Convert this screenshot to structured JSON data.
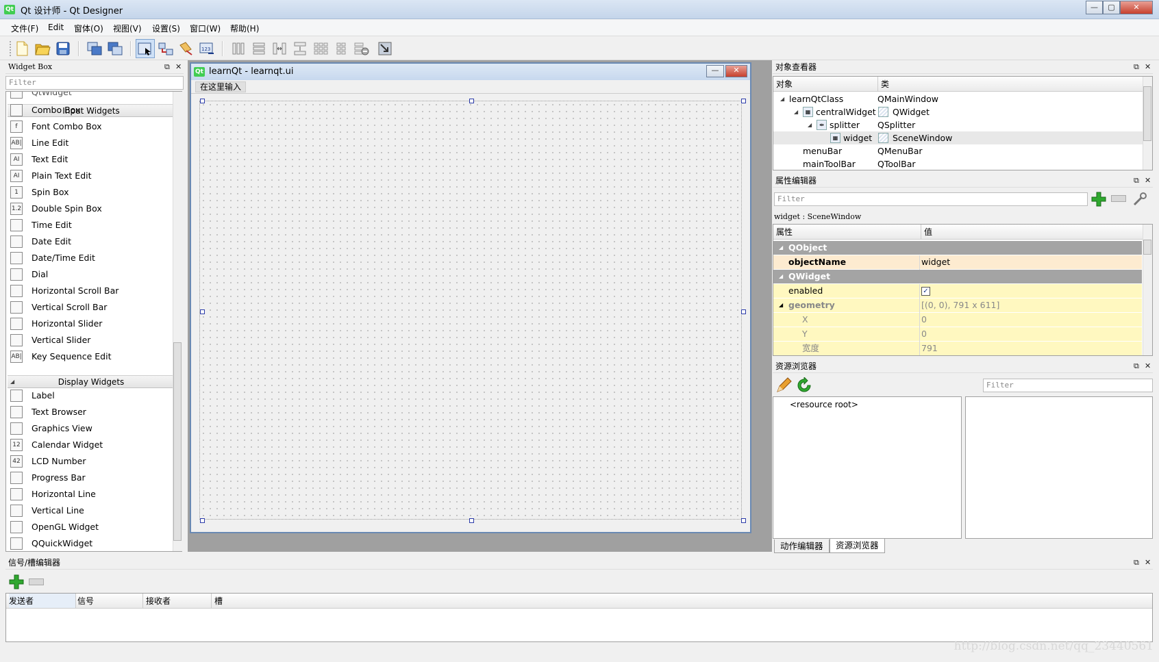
{
  "window": {
    "title": "Qt 设计师 - Qt Designer",
    "app_icon": "Qt",
    "min": "—",
    "max": "▢",
    "close": "✕"
  },
  "menubar": [
    "文件(F)",
    "Edit",
    "窗体(O)",
    "视图(V)",
    "设置(S)",
    "窗口(W)",
    "帮助(H)"
  ],
  "widget_box": {
    "title": "Widget Box",
    "filter_placeholder": "Filter",
    "partial_item": "QtWidget",
    "categories": [
      "Input Widgets",
      "Display Widgets"
    ],
    "input_widgets": [
      {
        "label": "Combo Box",
        "icon": "combo-box-icon"
      },
      {
        "label": "Font Combo Box",
        "icon": "font-combo-box-icon"
      },
      {
        "label": "Line Edit",
        "icon": "line-edit-icon"
      },
      {
        "label": "Text Edit",
        "icon": "text-edit-icon"
      },
      {
        "label": "Plain Text Edit",
        "icon": "plain-text-edit-icon"
      },
      {
        "label": "Spin Box",
        "icon": "spin-box-icon"
      },
      {
        "label": "Double Spin Box",
        "icon": "double-spin-box-icon"
      },
      {
        "label": "Time Edit",
        "icon": "time-edit-icon"
      },
      {
        "label": "Date Edit",
        "icon": "date-edit-icon"
      },
      {
        "label": "Date/Time Edit",
        "icon": "date-time-edit-icon"
      },
      {
        "label": "Dial",
        "icon": "dial-icon"
      },
      {
        "label": "Horizontal Scroll Bar",
        "icon": "horizontal-scroll-bar-icon"
      },
      {
        "label": "Vertical Scroll Bar",
        "icon": "vertical-scroll-bar-icon"
      },
      {
        "label": "Horizontal Slider",
        "icon": "horizontal-slider-icon"
      },
      {
        "label": "Vertical Slider",
        "icon": "vertical-slider-icon"
      },
      {
        "label": "Key Sequence Edit",
        "icon": "key-sequence-edit-icon"
      }
    ],
    "display_widgets": [
      {
        "label": "Label",
        "icon": "label-icon"
      },
      {
        "label": "Text Browser",
        "icon": "text-browser-icon"
      },
      {
        "label": "Graphics View",
        "icon": "graphics-view-icon"
      },
      {
        "label": "Calendar Widget",
        "icon": "calendar-widget-icon"
      },
      {
        "label": "LCD Number",
        "icon": "lcd-number-icon"
      },
      {
        "label": "Progress Bar",
        "icon": "progress-bar-icon"
      },
      {
        "label": "Horizontal Line",
        "icon": "horizontal-line-icon"
      },
      {
        "label": "Vertical Line",
        "icon": "vertical-line-icon"
      },
      {
        "label": "OpenGL Widget",
        "icon": "opengl-widget-icon"
      },
      {
        "label": "QQuickWidget",
        "icon": "qquickwidget-icon"
      }
    ],
    "icon_glyphs": {
      "line-edit-icon": "AB|",
      "text-edit-icon": "AI",
      "plain-text-edit-icon": "AI",
      "spin-box-icon": "1",
      "double-spin-box-icon": "1.2",
      "key-sequence-edit-icon": "AB|",
      "calendar-widget-icon": "12",
      "lcd-number-icon": "42",
      "font-combo-box-icon": "f"
    }
  },
  "form": {
    "title": "learnQt - learnqt.ui",
    "menu_placeholder": "在这里输入",
    "icon": "Qt"
  },
  "object_inspector": {
    "title": "对象查看器",
    "headers": [
      "对象",
      "类"
    ],
    "rows": [
      {
        "object": "learnQtClass",
        "class": "QMainWindow"
      },
      {
        "object": "centralWidget",
        "class": "QWidget"
      },
      {
        "object": "splitter",
        "class": "QSplitter"
      },
      {
        "object": "widget",
        "class": "SceneWindow"
      },
      {
        "object": "menuBar",
        "class": "QMenuBar"
      },
      {
        "object": "mainToolBar",
        "class": "QToolBar"
      }
    ]
  },
  "property_editor": {
    "title": "属性编辑器",
    "filter_placeholder": "Filter",
    "current": "widget : SceneWindow",
    "headers": [
      "属性",
      "值"
    ],
    "rows": [
      {
        "name": "QObject",
        "value": "",
        "group": true
      },
      {
        "name": "objectName",
        "value": "widget"
      },
      {
        "name": "QWidget",
        "value": "",
        "group": true
      },
      {
        "name": "enabled",
        "value": "✓"
      },
      {
        "name": "geometry",
        "value": "[(0, 0), 791 x 611]"
      },
      {
        "name": "X",
        "value": "0"
      },
      {
        "name": "Y",
        "value": "0"
      },
      {
        "name": "宽度",
        "value": "791"
      }
    ]
  },
  "resource_browser": {
    "title": "资源浏览器",
    "filter_placeholder": "Filter",
    "root": "<resource root>",
    "tabs": [
      "动作编辑器",
      "资源浏览器"
    ]
  },
  "signal_slot": {
    "title": "信号/槽编辑器",
    "headers": [
      "发送者",
      "信号",
      "接收者",
      "槽"
    ]
  },
  "watermark": "http://blog.csdn.net/qq_23440561",
  "colors": {
    "accent": "#3a8ee6",
    "group_bg": "#a4a4a4",
    "object_name_bg": "#fdebd0",
    "dynamic_prop_bg": "#fff8c0",
    "add_green": "#2fa82f"
  }
}
